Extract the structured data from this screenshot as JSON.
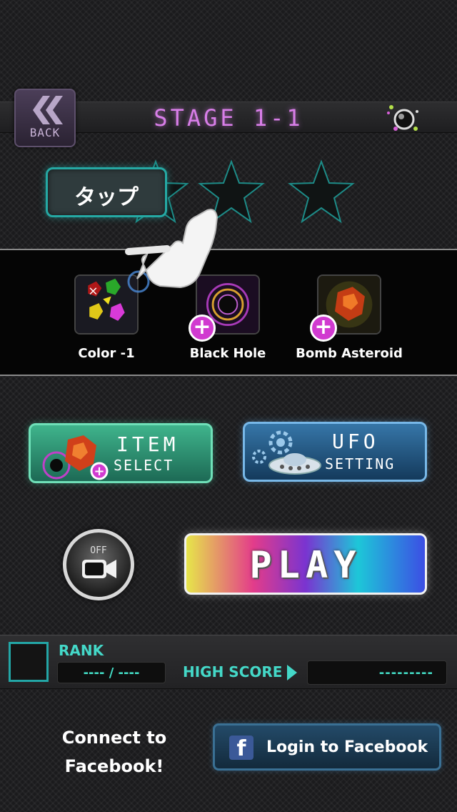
{
  "header": {
    "back_label": "BACK",
    "stage_title": "STAGE 1-1"
  },
  "tutorial": {
    "tap_text": "タップ"
  },
  "stars": {
    "earned": 0,
    "total": 3
  },
  "items": [
    {
      "label": "Color -1",
      "icon": "gem-colors-icon"
    },
    {
      "label": "Black Hole",
      "icon": "black-hole-icon"
    },
    {
      "label": "Bomb Asteroid",
      "icon": "bomb-asteroid-icon"
    }
  ],
  "buttons": {
    "item_select_line1": "ITEM",
    "item_select_line2": "SELECT",
    "ufo_setting_line1": "UFO",
    "ufo_setting_line2": "SETTING",
    "play": "PLAY",
    "camera_state": "OFF"
  },
  "rank": {
    "label": "RANK",
    "value": "---- / ----",
    "highscore_label": "HIGH SCORE",
    "highscore_value": "---------"
  },
  "facebook": {
    "connect_text_line1": "Connect to",
    "connect_text_line2": "Facebook!",
    "login_label": "Login to Facebook",
    "icon_letter": "f"
  },
  "colors": {
    "accent_teal": "#44d8c8",
    "title_purple": "#d87ee8",
    "facebook_blue": "#3b5998"
  }
}
